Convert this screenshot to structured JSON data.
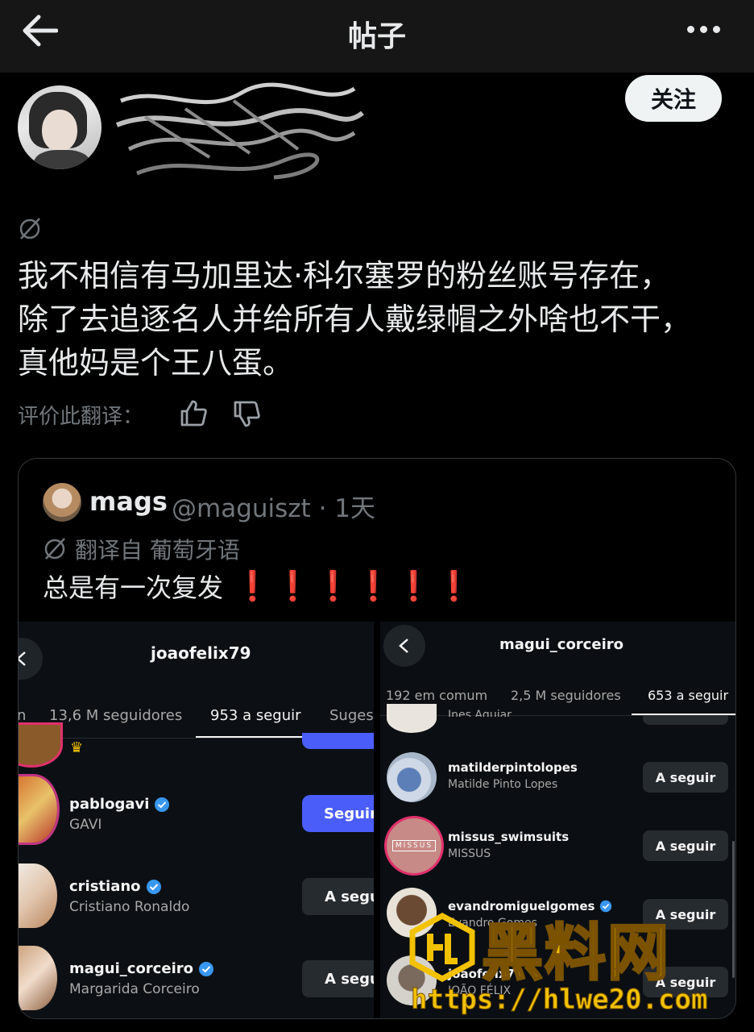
{
  "topbar": {
    "title": "帖子"
  },
  "author": {
    "follow_label": "关注"
  },
  "post": {
    "text": "我不相信有马加里达·科尔塞罗的粉丝账号存在，\n除了去追逐名人并给所有人戴绿帽之外啥也不干，\n真他妈是个王八蛋。",
    "rate_label": "评价此翻译："
  },
  "quote": {
    "name": "mags",
    "handle_time": "@maguiszt · 1天",
    "translated_from": "翻译自 葡萄牙语",
    "text": "总是有一次复发",
    "exclaims": [
      "❗",
      "❗",
      "❗",
      "❗",
      "❗",
      "❗"
    ]
  },
  "left_shot": {
    "title": "joaofelix79",
    "tabs": [
      "n",
      "13,6 M seguidores",
      "953 a seguir",
      "Suges"
    ],
    "rows": [
      {
        "name": "pablogavi",
        "sub": "GAVI",
        "button": "Seguir"
      },
      {
        "name": "cristiano",
        "sub": "Cristiano Ronaldo",
        "button": "A segu"
      },
      {
        "name": "magui_corceiro",
        "sub": "Margarida Corceiro",
        "button": "A segu"
      }
    ]
  },
  "right_shot": {
    "title": "magui_corceiro",
    "tabs": [
      "192 em comum",
      "2,5 M seguidores",
      "653 a seguir"
    ],
    "top_partial_sub": "Ines Aguiar",
    "rows": [
      {
        "name": "matilderpintolopes",
        "sub": "Matilde Pinto Lopes",
        "button": "A seguir"
      },
      {
        "name": "missus_swimsuits",
        "sub": "MISSUS",
        "button": "A seguir",
        "avatar_text": "MISSUS"
      },
      {
        "name": "evandromiguelgomes",
        "sub": "Evandro Gomes",
        "button": "A seguir"
      },
      {
        "name": "joaofelix79",
        "sub": "JOÃO FÉLIX",
        "button": "A seguir"
      }
    ]
  },
  "watermark": {
    "cn": "黑料网",
    "url": "https://hlwe20.com"
  },
  "colors": {
    "blue_button": "#4a5df9",
    "verified": "#3897f0",
    "exclaim": "#e0262d",
    "watermark": "#f2c200"
  }
}
